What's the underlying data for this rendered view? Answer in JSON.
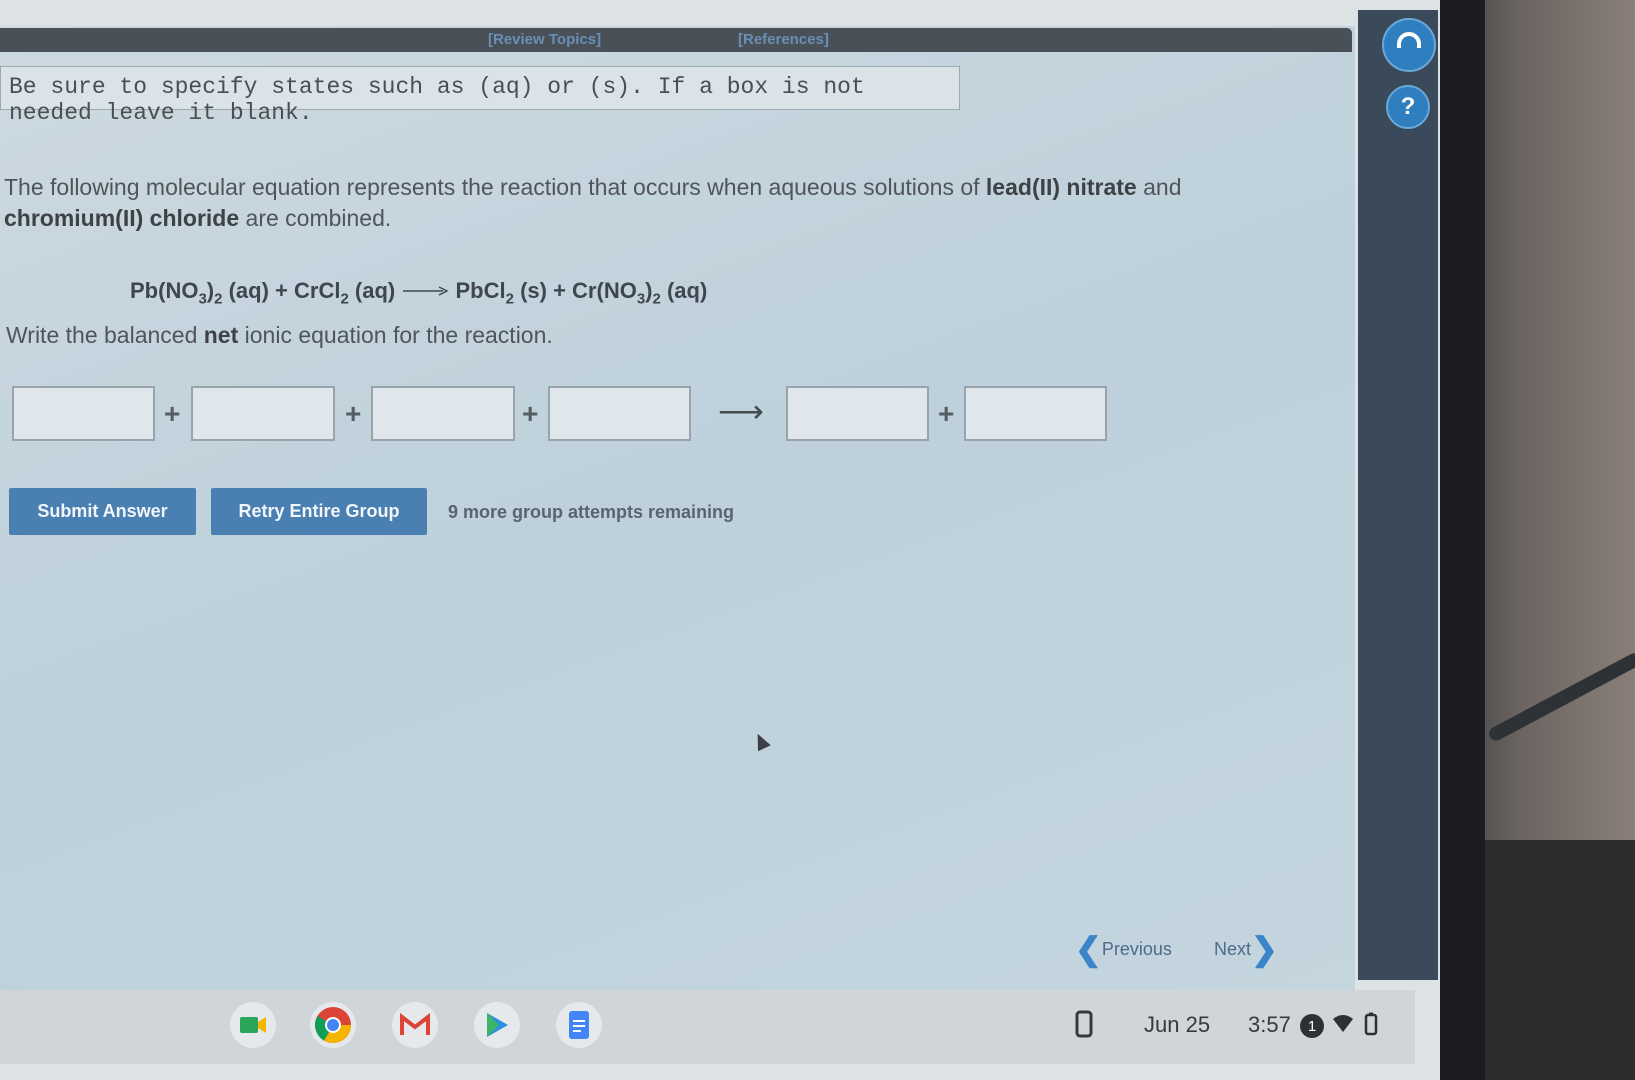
{
  "toolbar": {
    "review_topics": "[Review Topics]",
    "references": "[References]"
  },
  "instruction": "Be sure to specify states such as (aq) or (s). If a box is not needed leave it blank.",
  "question": {
    "text_1": "The following molecular equation represents the reaction that occurs when aqueous solutions of ",
    "bold_1": "lead(II) nitrate",
    "text_2": " and ",
    "bold_2": "chromium(II) chloride",
    "text_3": " are combined."
  },
  "equation": {
    "r1_a": "Pb(NO",
    "r1_sub1": "3",
    "r1_b": ")",
    "r1_sub2": "2",
    "r1_state": " (aq)",
    "plus1": " + ",
    "r2_a": "CrCl",
    "r2_sub": "2",
    "r2_state": " (aq)",
    "p1_a": "PbCl",
    "p1_sub": "2",
    "p1_state": " (s)",
    "plus2": " + ",
    "p2_a": "Cr(NO",
    "p2_sub1": "3",
    "p2_b": ")",
    "p2_sub2": "2",
    "p2_state": " (aq)"
  },
  "prompt": {
    "text_1": "Write the balanced ",
    "bold": "net",
    "text_2": " ionic equation for the reaction."
  },
  "answer": {
    "plus": "+",
    "arrow": "⟶"
  },
  "buttons": {
    "submit": "Submit Answer",
    "retry": "Retry Entire Group"
  },
  "attempts": "9 more group attempts remaining",
  "nav": {
    "previous": "Previous",
    "next": "Next"
  },
  "side_panel": {
    "help_glyph": "?"
  },
  "shelf": {
    "date": "Jun 25",
    "time": "3:57",
    "notification_count": "1"
  }
}
